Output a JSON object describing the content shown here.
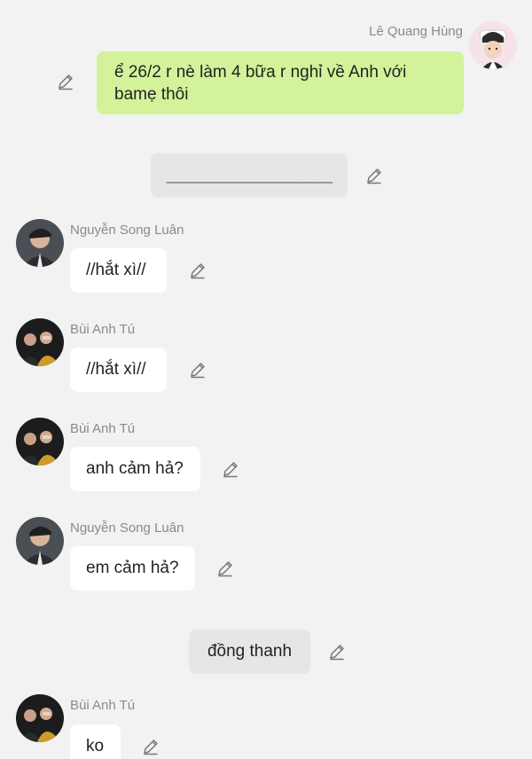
{
  "messages": [
    {
      "sender": "Lê Quang Hùng",
      "text": "ể 26/2 r nè làm 4 bữa r nghỉ về Anh với bamẹ thôi",
      "self": true
    },
    {
      "text": "______________________",
      "system": true
    },
    {
      "sender": "Nguyễn Song Luân",
      "text": "//hắt xì//"
    },
    {
      "sender": "Bùi Anh Tú",
      "text": "//hắt xì//"
    },
    {
      "sender": "Bùi Anh Tú",
      "text": "anh cảm hả?"
    },
    {
      "sender": "Nguyễn Song Luân",
      "text": "em cảm hả?"
    },
    {
      "text": "đồng thanh",
      "system": true
    },
    {
      "sender": "Bùi Anh Tú",
      "text": "ko"
    }
  ],
  "icons": {
    "edit": "pencil-edit-icon",
    "avatar": "user-avatar"
  },
  "colors": {
    "background": "#f2f2f2",
    "self_bubble": "#d4f29a",
    "other_bubble": "#ffffff",
    "system_bubble": "#e6e6e6",
    "sender_name": "#8a8a8a"
  }
}
